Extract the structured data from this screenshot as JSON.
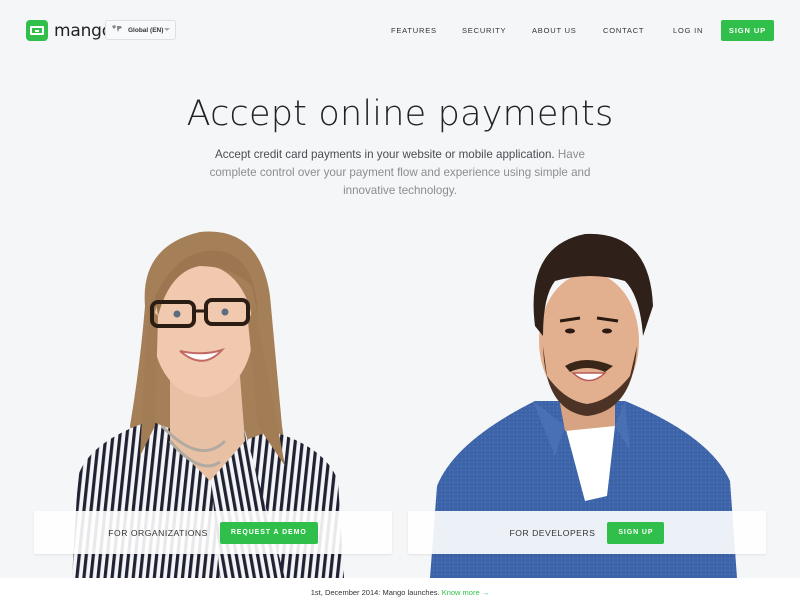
{
  "brand": {
    "name": "mango",
    "accent_color": "#2fbf4a"
  },
  "header": {
    "language_selector": {
      "icon": "world-map-icon",
      "value": "Global (EN)"
    },
    "nav": [
      {
        "label": "FEATURES"
      },
      {
        "label": "SECURITY"
      },
      {
        "label": "ABOUT US"
      },
      {
        "label": "CONTACT"
      },
      {
        "label": "LOG IN"
      }
    ],
    "signup_label": "SIGN UP"
  },
  "hero": {
    "title": "Accept online payments",
    "subtitle_strong": "Accept credit card payments in your website or mobile application.",
    "subtitle_rest": " Have complete control over your payment flow and experience using simple and innovative technology."
  },
  "cards": {
    "organizations": {
      "label": "FOR ORGANIZATIONS",
      "button": "REQUEST A DEMO"
    },
    "developers": {
      "label": "FOR DEVELOPERS",
      "button": "SIGN UP"
    }
  },
  "footer": {
    "announcement": "1st, December 2014: Mango launches. ",
    "link": "Know more →"
  }
}
